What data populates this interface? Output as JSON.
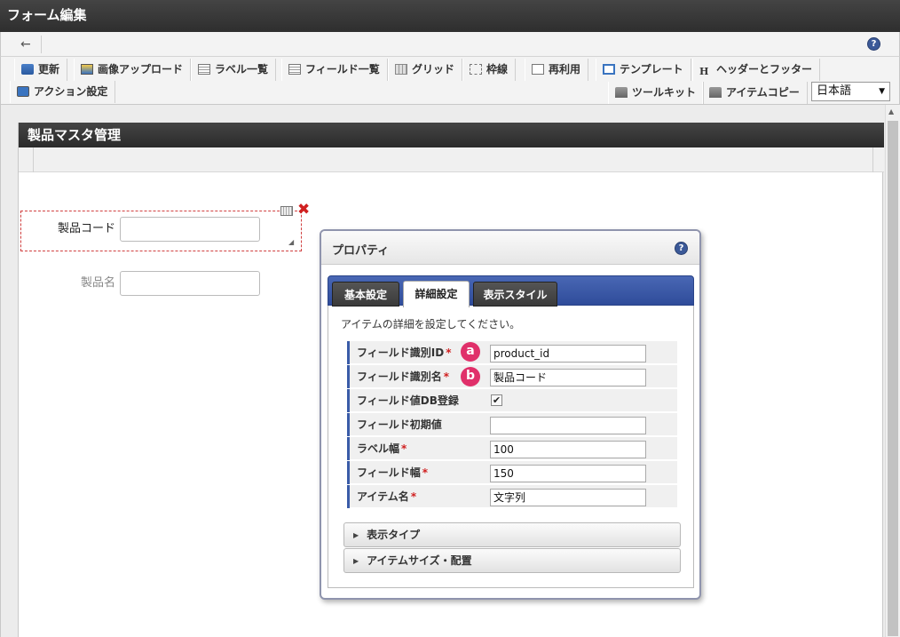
{
  "window": {
    "title": "フォーム編集"
  },
  "nav": {
    "back_icon": "←",
    "help_icon": "?"
  },
  "toolbar": {
    "buttons": [
      {
        "label": "更新",
        "icon": "refresh-icon"
      },
      {
        "label": "画像アップロード",
        "icon": "image-upload-icon"
      },
      {
        "label": "ラベル一覧",
        "icon": "label-list-icon"
      },
      {
        "label": "フィールド一覧",
        "icon": "field-list-icon"
      },
      {
        "label": "グリッド",
        "icon": "grid-icon"
      },
      {
        "label": "枠線",
        "icon": "border-icon"
      },
      {
        "label": "再利用",
        "icon": "reuse-icon"
      },
      {
        "label": "テンプレート",
        "icon": "template-icon"
      },
      {
        "label": "ヘッダーとフッター",
        "icon": "header-footer-icon"
      },
      {
        "label": "アクション設定",
        "icon": "action-icon"
      },
      {
        "label": "ツールキット",
        "icon": "toolkit-icon"
      },
      {
        "label": "アイテムコピー",
        "icon": "item-copy-icon"
      }
    ],
    "language": "日本語",
    "h_glyph": "H"
  },
  "form": {
    "title": "製品マスタ管理",
    "fields": [
      {
        "label": "製品コード",
        "value": ""
      },
      {
        "label": "製品名",
        "value": ""
      }
    ],
    "delete_glyph": "✖"
  },
  "properties": {
    "title": "プロパティ",
    "help_icon": "?",
    "tabs": [
      "基本設定",
      "詳細設定",
      "表示スタイル"
    ],
    "active_tab": "詳細設定",
    "description": "アイテムの詳細を設定してください。",
    "rows": [
      {
        "label": "フィールド識別ID",
        "required": "*",
        "value": "product_id",
        "marker": "a"
      },
      {
        "label": "フィールド識別名",
        "required": "*",
        "value": "製品コード",
        "marker": "b"
      },
      {
        "label": "フィールド値DB登録",
        "checked": "✔"
      },
      {
        "label": "フィールド初期値",
        "value": ""
      },
      {
        "label": "ラベル幅",
        "required": "*",
        "value": "100"
      },
      {
        "label": "フィールド幅",
        "required": "*",
        "value": "150"
      },
      {
        "label": "アイテム名",
        "required": "*",
        "value": "文字列"
      }
    ],
    "sections": [
      {
        "label": "表示タイプ",
        "arrow": "▶"
      },
      {
        "label": "アイテムサイズ・配置",
        "arrow": "▶"
      }
    ]
  },
  "colors": {
    "accent": "#3a5ca8",
    "marker": "#e0306a",
    "delete": "#d02020"
  }
}
